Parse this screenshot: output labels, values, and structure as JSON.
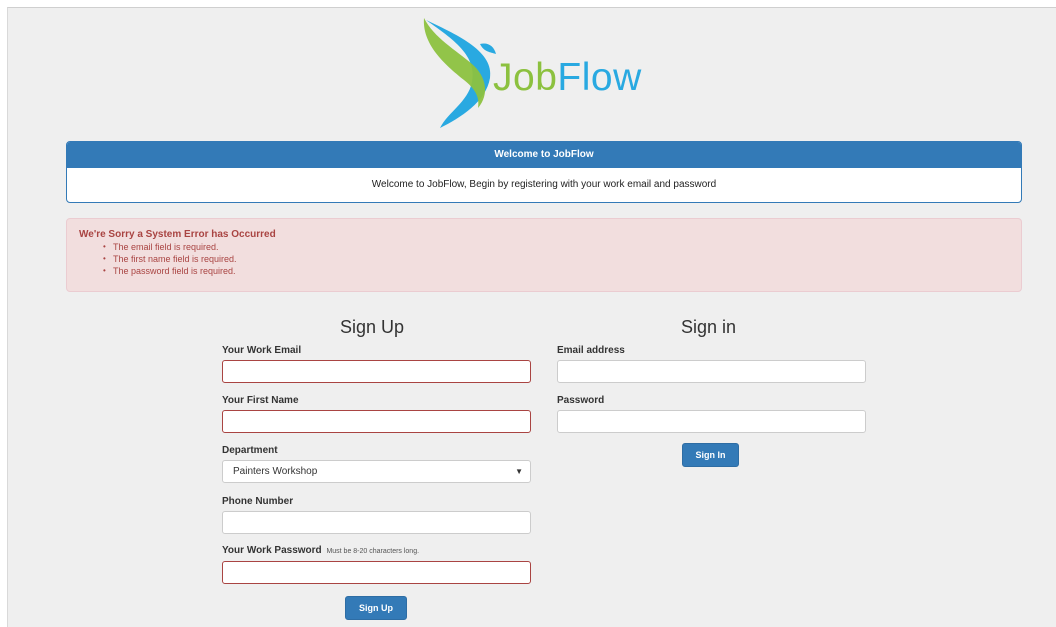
{
  "logo": {
    "word_part1": "Job",
    "word_part2": "Flow"
  },
  "welcome_panel": {
    "heading": "Welcome to JobFlow",
    "body": "Welcome to JobFlow, Begin by registering with your work email and password"
  },
  "error_alert": {
    "title": "We're Sorry a System Error has Occurred",
    "items": [
      "The email field is required.",
      "The first name field is required.",
      "The password field is required."
    ]
  },
  "signup": {
    "title": "Sign Up",
    "email_label": "Your Work Email",
    "email_value": "",
    "first_name_label": "Your First Name",
    "first_name_value": "",
    "department_label": "Department",
    "department_selected": "Painters Workshop",
    "phone_label": "Phone Number",
    "phone_value": "",
    "password_label": "Your Work Password",
    "password_hint": "Must be 8-20 characters long.",
    "password_value": "",
    "button": "Sign Up"
  },
  "signin": {
    "title": "Sign in",
    "email_label": "Email address",
    "email_value": "",
    "password_label": "Password",
    "password_value": "",
    "button": "Sign In"
  },
  "colors": {
    "primary": "#337ab7",
    "error_text": "#a94442",
    "error_bg": "#f2dede",
    "logo_green": "#8cc13f",
    "logo_blue": "#29a9e1"
  },
  "icons": {
    "select_arrow": "chevron-down-icon"
  }
}
